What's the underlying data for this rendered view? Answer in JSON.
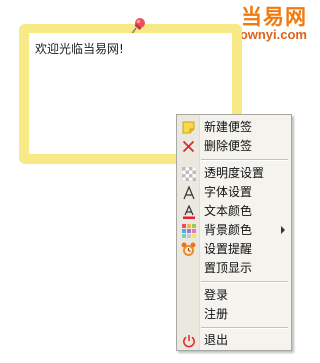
{
  "watermark": {
    "brand": "当易网",
    "domain": "downyi.com"
  },
  "note": {
    "text": "欢迎光临当易网!"
  },
  "menu": {
    "items": [
      {
        "label": "新建便签",
        "icon": "new-note-icon"
      },
      {
        "label": "删除便签",
        "icon": "delete-icon"
      },
      {
        "label": "透明度设置",
        "icon": "transparency-icon"
      },
      {
        "label": "字体设置",
        "icon": "font-icon"
      },
      {
        "label": "文本颜色",
        "icon": "text-color-icon"
      },
      {
        "label": "背景颜色",
        "icon": "background-color-icon",
        "submenu": true
      },
      {
        "label": "设置提醒",
        "icon": "alarm-icon"
      },
      {
        "label": "置顶显示",
        "icon": ""
      },
      {
        "label": "登录",
        "icon": ""
      },
      {
        "label": "注册",
        "icon": ""
      },
      {
        "label": "退出",
        "icon": "power-icon"
      }
    ]
  },
  "colors": {
    "note_border": "#f8e987",
    "menu_bg": "#f4f3ee",
    "accent_red": "#e0262a",
    "brand_orange": "#f07a10"
  }
}
